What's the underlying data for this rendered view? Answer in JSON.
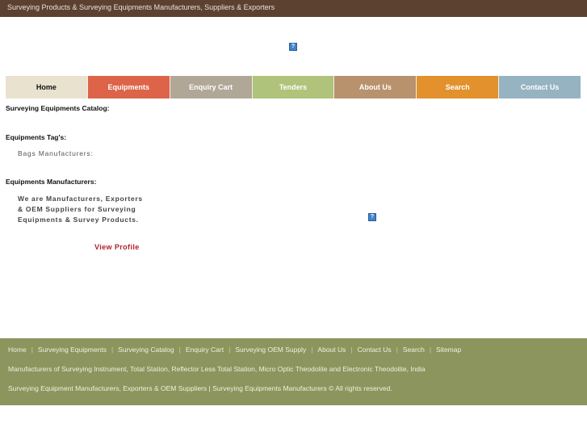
{
  "topbar": {
    "title": "Surveying Products & Surveying Equipments Manufacturers, Suppliers & Exporters",
    "color": "#5c4130"
  },
  "banner": {
    "icon": "broken-image-icon",
    "glyph": "?"
  },
  "nav": {
    "items": [
      {
        "label": "Home",
        "color": "#e8e2ce",
        "text_color": "#111111"
      },
      {
        "label": "Equipments",
        "color": "#dd6449",
        "text_color": "#ffffff"
      },
      {
        "label": "Enquiry Cart",
        "color": "#b1a797",
        "text_color": "#ffffff"
      },
      {
        "label": "Tenders",
        "color": "#afc37b",
        "text_color": "#ffffff"
      },
      {
        "label": "About Us",
        "color": "#b8926c",
        "text_color": "#ffffff"
      },
      {
        "label": "Search",
        "color": "#e2912c",
        "text_color": "#ffffff"
      },
      {
        "label": "Contact Us",
        "color": "#95b3c0",
        "text_color": "#ffffff"
      }
    ]
  },
  "content": {
    "catalog_heading": "Surveying Equipments Catalog:",
    "tags_heading": "Equipments Tag's:",
    "tags": [
      "Bags Manufacturers:"
    ],
    "manufacturers_heading": "Equipments Manufacturers:",
    "intro_text": "We are Manufacturers, Exporters & OEM Suppliers for Surveying Equipments & Survey Products.",
    "view_profile": "View Profile",
    "main_image_glyph": "?"
  },
  "footer": {
    "color": "#8d955e",
    "links": [
      "Home",
      "Surveying Equipments",
      "Surveying Catalog",
      "Enquiry Cart",
      "Surveying OEM Supply",
      "About Us",
      "Contact Us",
      "Search",
      "Sitemap"
    ],
    "separator": "|",
    "line1": "Manufacturers of Surveying Instrument, Total Station, Reflector Less Total Station, Micro Optic Theodolite and Electronic Theodolite, India",
    "line2": "Surveying Equipment Manufacturers, Exporters & OEM Suppliers | Surveying Equipments Manufacturers © All rights reserved."
  }
}
